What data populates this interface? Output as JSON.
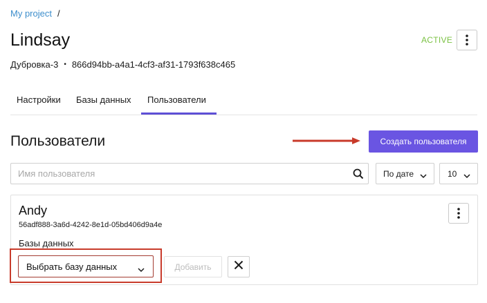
{
  "breadcrumb": {
    "project_link": "My project",
    "separator": "/"
  },
  "header": {
    "title": "Lindsay",
    "status": "ACTIVE",
    "region": "Дубровка-3",
    "separator": "•",
    "instance_id": "866d94bb-a4a1-4cf3-af31-1793f638c465"
  },
  "tabs": [
    {
      "label": "Настройки"
    },
    {
      "label": "Базы данных"
    },
    {
      "label": "Пользователи",
      "active": true
    }
  ],
  "section": {
    "title": "Пользователи",
    "create_button": "Создать пользователя"
  },
  "filters": {
    "search_placeholder": "Имя пользователя",
    "sort_value": "По дате",
    "page_size_value": "10"
  },
  "user_card": {
    "name": "Andy",
    "id": "56adf888-3a6d-4242-8e1d-05bd406d9a4e",
    "databases_label": "Базы данных",
    "database_select_value": "Выбрать базу данных",
    "add_button": "Добавить"
  },
  "colors": {
    "accent": "#6a55e2",
    "link": "#3d8ecc",
    "status_active": "#7ac142",
    "annotation_red": "#c83a2a"
  },
  "icons": {
    "kebab": "more-vertical-icon",
    "search": "search-icon",
    "chevron": "chevron-down-icon",
    "close": "close-icon",
    "annotation": "arrow-right-icon"
  }
}
